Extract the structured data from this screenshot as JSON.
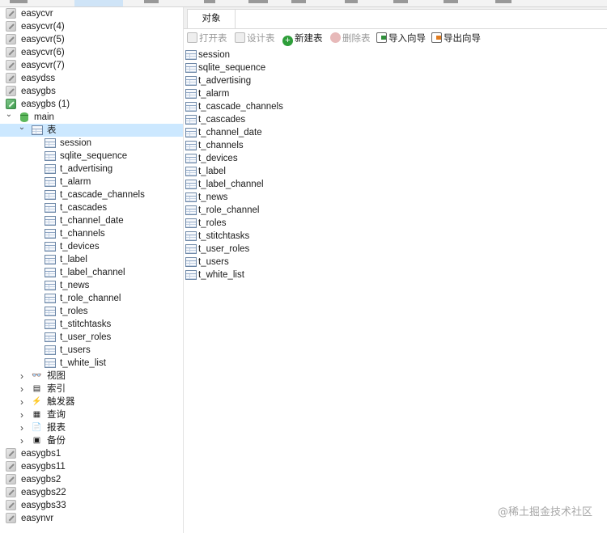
{
  "tree": {
    "connections_top": [
      {
        "label": "easycvr",
        "open": false
      },
      {
        "label": "easycvr(4)",
        "open": false
      },
      {
        "label": "easycvr(5)",
        "open": false
      },
      {
        "label": "easycvr(6)",
        "open": false
      },
      {
        "label": "easycvr(7)",
        "open": false
      },
      {
        "label": "easydss",
        "open": false
      },
      {
        "label": "easygbs",
        "open": false
      },
      {
        "label": "easygbs (1)",
        "open": true
      }
    ],
    "database": "main",
    "tables_node": "表",
    "tables": [
      "session",
      "sqlite_sequence",
      "t_advertising",
      "t_alarm",
      "t_cascade_channels",
      "t_cascades",
      "t_channel_date",
      "t_channels",
      "t_devices",
      "t_label",
      "t_label_channel",
      "t_news",
      "t_role_channel",
      "t_roles",
      "t_stitchtasks",
      "t_user_roles",
      "t_users",
      "t_white_list"
    ],
    "other_nodes": [
      {
        "label": "视图",
        "icon": "glasses-icon",
        "glyph": "👓"
      },
      {
        "label": "索引",
        "icon": "index-icon",
        "glyph": "▤"
      },
      {
        "label": "触发器",
        "icon": "lightning-icon",
        "glyph": "⚡"
      },
      {
        "label": "查询",
        "icon": "query-icon",
        "glyph": "▦"
      },
      {
        "label": "报表",
        "icon": "report-icon",
        "glyph": "📄"
      },
      {
        "label": "备份",
        "icon": "backup-icon",
        "glyph": "▣"
      }
    ],
    "connections_bottom": [
      "easygbs1",
      "easygbs11",
      "easygbs2",
      "easygbs22",
      "easygbs33",
      "easynvr"
    ]
  },
  "tab": {
    "label": "对象"
  },
  "toolbar": {
    "open_table": "打开表",
    "design_table": "设计表",
    "new_table": "新建表",
    "delete_table": "删除表",
    "import_wizard": "导入向导",
    "export_wizard": "导出向导"
  },
  "objects": [
    "session",
    "sqlite_sequence",
    "t_advertising",
    "t_alarm",
    "t_cascade_channels",
    "t_cascades",
    "t_channel_date",
    "t_channels",
    "t_devices",
    "t_label",
    "t_label_channel",
    "t_news",
    "t_role_channel",
    "t_roles",
    "t_stitchtasks",
    "t_user_roles",
    "t_users",
    "t_white_list"
  ],
  "watermark": "@稀土掘金技术社区",
  "colors": {
    "selection": "#cce8ff",
    "active_menu": "#cfe4f7",
    "new_icon": "#2e9e3a",
    "import_icon": "#2f8f3a",
    "export_icon": "#e07b20"
  }
}
